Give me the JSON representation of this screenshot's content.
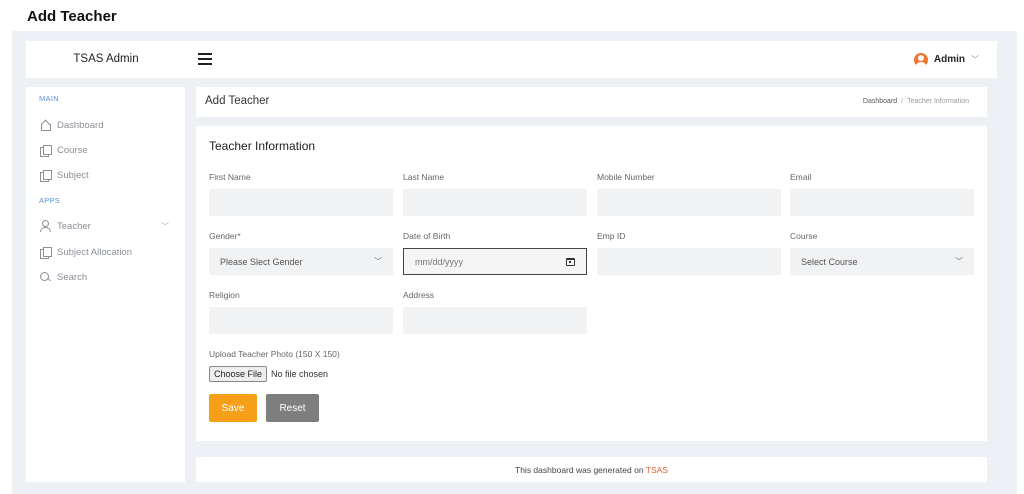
{
  "page": {
    "heading": "Add Teacher"
  },
  "topbar": {
    "brand": "TSAS Admin",
    "user_name": "Admin"
  },
  "sidebar": {
    "sections": [
      {
        "label": "MAIN"
      },
      {
        "label": "APPS"
      }
    ],
    "items": [
      {
        "label": "Dashboard",
        "icon": "home-icon"
      },
      {
        "label": "Course",
        "icon": "document-icon"
      },
      {
        "label": "Subject",
        "icon": "document-icon"
      },
      {
        "label": "Teacher",
        "icon": "user-icon"
      },
      {
        "label": "Subject Allocation",
        "icon": "document-icon"
      },
      {
        "label": "Search",
        "icon": "search-icon"
      }
    ]
  },
  "breadcrumb_bar": {
    "title": "Add Teacher",
    "crumbs": [
      "Dashboard",
      "Teacher Information"
    ]
  },
  "form": {
    "title": "Teacher Information",
    "fields": {
      "first_name": {
        "label": "First Name",
        "value": ""
      },
      "last_name": {
        "label": "Last Name",
        "value": ""
      },
      "mobile": {
        "label": "Mobile Number",
        "value": ""
      },
      "email": {
        "label": "Email",
        "value": ""
      },
      "gender": {
        "label": "Gender*",
        "selected": "Please Slect Gender"
      },
      "dob": {
        "label": "Date of Birth",
        "placeholder": "mm/dd/yyyy"
      },
      "emp_id": {
        "label": "Emp ID",
        "value": ""
      },
      "course": {
        "label": "Course",
        "selected": "Select Course"
      },
      "religion": {
        "label": "Religion",
        "value": ""
      },
      "address": {
        "label": "Address",
        "value": ""
      }
    },
    "upload": {
      "label": "Upload Teacher Photo (150 X 150)",
      "button": "Choose File",
      "status": "No file chosen"
    },
    "buttons": {
      "save": "Save",
      "reset": "Reset"
    }
  },
  "footer": {
    "text": "This dashboard was generated on",
    "brand": "TSAS"
  },
  "colors": {
    "accent": "#f6a019",
    "link": "#e25d3b",
    "section": "#5b8fd8",
    "user_icon": "#f0762e"
  }
}
